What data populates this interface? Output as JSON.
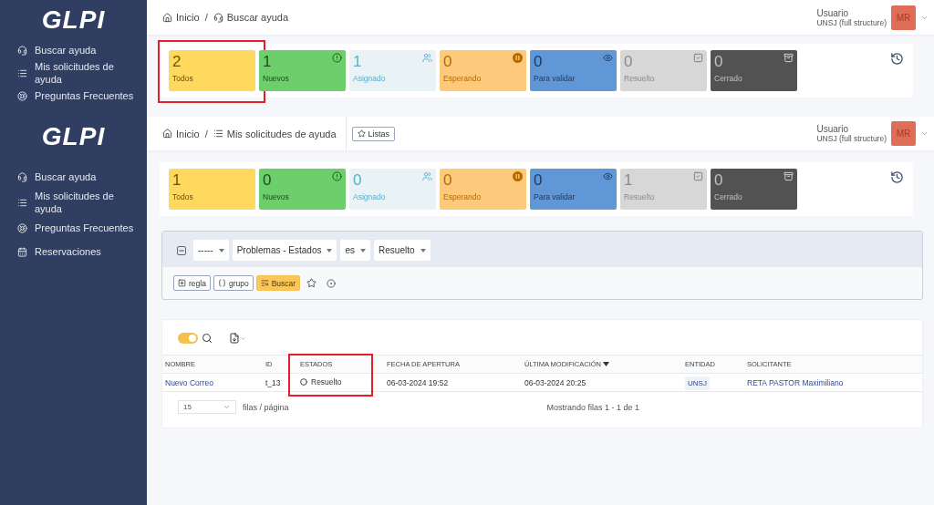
{
  "panes": [
    {
      "sidebar": {
        "logo": "GLPI",
        "items": [
          {
            "label": "Buscar ayuda"
          },
          {
            "label": "Mis solicitudes de ayuda"
          },
          {
            "label": "Preguntas Frecuentes"
          }
        ]
      },
      "breadcrumb": [
        {
          "label": "Inicio"
        },
        {
          "label": "Buscar ayuda"
        }
      ],
      "breadcrumb_separator": "/",
      "user": {
        "name": "Usuario",
        "entity": "UNSJ (full structure)",
        "initials": "MR"
      },
      "status_cards": [
        {
          "count": "2",
          "label": "Todos",
          "color": "#ffd85e",
          "highlighted": true
        },
        {
          "count": "1",
          "label": "Nuevos",
          "color": "#6dcf6b",
          "highlighted": false
        },
        {
          "count": "1",
          "label": "Asignado",
          "color": "#e9f3f6",
          "highlighted": false
        },
        {
          "count": "0",
          "label": "Esperando",
          "color": "#fdca7c",
          "highlighted": false
        },
        {
          "count": "0",
          "label": "Para validar",
          "color": "#6097d7",
          "highlighted": false
        },
        {
          "count": "0",
          "label": "Resuelto",
          "color": "#d7d7d7",
          "highlighted": false
        },
        {
          "count": "0",
          "label": "Cerrado",
          "color": "#525252",
          "highlighted": false
        }
      ]
    },
    {
      "sidebar": {
        "logo": "GLPI",
        "items": [
          {
            "label": "Buscar ayuda"
          },
          {
            "label": "Mis solicitudes de ayuda"
          },
          {
            "label": "Preguntas Frecuentes"
          },
          {
            "label": "Reservaciones"
          }
        ]
      },
      "breadcrumb": [
        {
          "label": "Inicio"
        },
        {
          "label": "Mis solicitudes de ayuda"
        }
      ],
      "breadcrumb_separator": "/",
      "lists_button": "Listas",
      "user": {
        "name": "Usuario",
        "entity": "UNSJ (full structure)",
        "initials": "MR"
      },
      "status_cards": [
        {
          "count": "1",
          "label": "Todos",
          "color": "#ffd85e",
          "highlighted": false
        },
        {
          "count": "0",
          "label": "Nuevos",
          "color": "#6dcf6b",
          "highlighted": false
        },
        {
          "count": "0",
          "label": "Asignado",
          "color": "#e9f3f6",
          "highlighted": false
        },
        {
          "count": "0",
          "label": "Esperando",
          "color": "#fdca7c",
          "highlighted": false
        },
        {
          "count": "0",
          "label": "Para validar",
          "color": "#6097d7",
          "highlighted": false
        },
        {
          "count": "1",
          "label": "Resuelto",
          "color": "#d7d7d7",
          "highlighted": false
        },
        {
          "count": "0",
          "label": "Cerrado",
          "color": "#525252",
          "highlighted": false
        }
      ],
      "filter": {
        "expanded": true,
        "criteria": [
          "-----",
          "Problemas - Estados",
          "es",
          "Resuelto"
        ],
        "buttons": [
          "regla",
          "grupo",
          "Buscar"
        ]
      },
      "table": {
        "toggle_on": true,
        "columns": [
          {
            "label": "NOMBRE",
            "sorted": false,
            "highlighted": false
          },
          {
            "label": "ID",
            "sorted": false,
            "highlighted": false
          },
          {
            "label": "ESTADOS",
            "sorted": false,
            "highlighted": true
          },
          {
            "label": "FECHA DE APERTURA",
            "sorted": false,
            "highlighted": false
          },
          {
            "label": "ÚLTIMA MODIFICACIÓN",
            "sorted": true,
            "highlighted": false
          },
          {
            "label": "ENTIDAD",
            "sorted": false,
            "highlighted": false
          },
          {
            "label": "SOLICITANTE",
            "sorted": false,
            "highlighted": false
          }
        ],
        "rows": [
          {
            "name": "Nuevo Correo",
            "id": "t_13",
            "status": "Resuelto",
            "opened": "06-03-2024 19:52",
            "modified": "06-03-2024 20:25",
            "entity": "UNSJ",
            "requester": "RETA PASTOR Maximiliano"
          }
        ],
        "page_size": "15",
        "page_size_label": "filas / página",
        "summary": "Mostrando filas 1 - 1 de 1"
      }
    }
  ]
}
